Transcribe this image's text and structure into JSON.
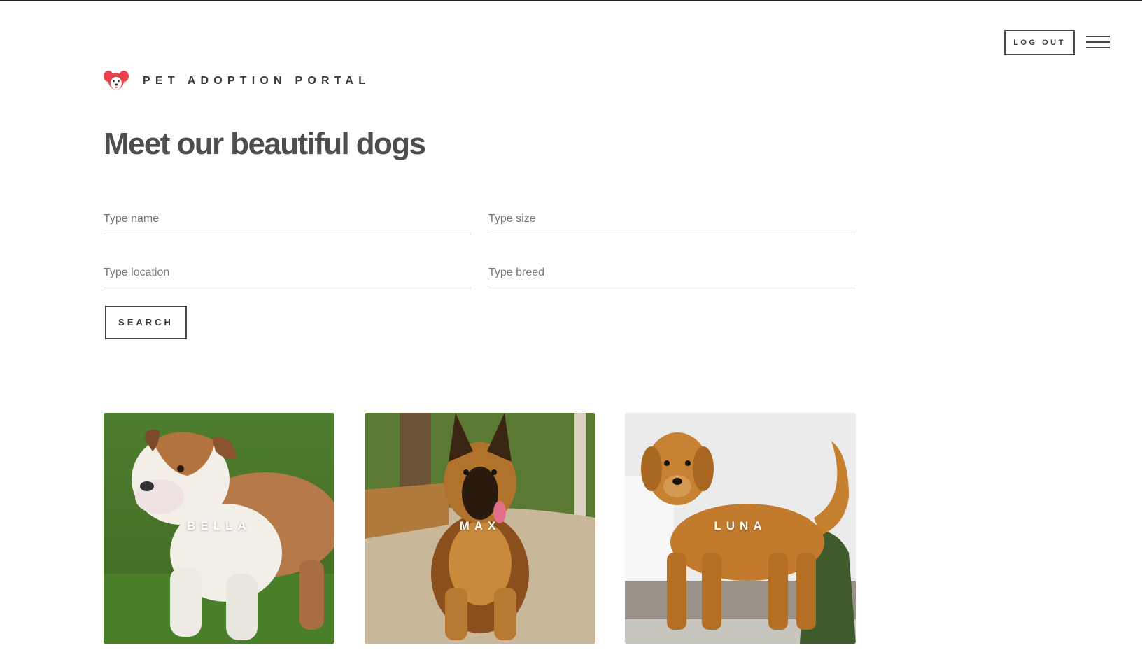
{
  "header": {
    "logout_label": "LOG OUT",
    "menu_icon": "hamburger-menu-icon"
  },
  "brand": {
    "logo_icon": "dog-face-icon",
    "name": "PET ADOPTION PORTAL",
    "accent_color": "#e8424f"
  },
  "page": {
    "title": "Meet our beautiful dogs"
  },
  "search": {
    "name_placeholder": "Type name",
    "size_placeholder": "Type size",
    "location_placeholder": "Type location",
    "breed_placeholder": "Type breed",
    "button_label": "SEARCH"
  },
  "dogs": [
    {
      "name": "BELLA"
    },
    {
      "name": "MAX"
    },
    {
      "name": "LUNA"
    }
  ]
}
